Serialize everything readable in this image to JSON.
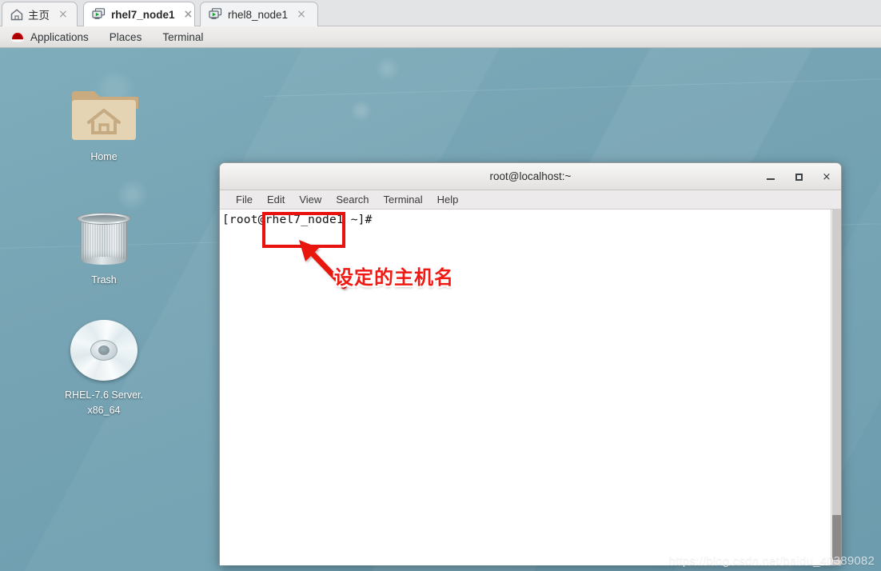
{
  "vmware_tabs": {
    "tabs": [
      {
        "label": "主页",
        "icon": "home-icon",
        "close": "×",
        "active": false
      },
      {
        "label": "rhel7_node1",
        "icon": "vm-icon",
        "close": "×",
        "active": true
      },
      {
        "label": "rhel8_node1",
        "icon": "vm-icon",
        "close": "×",
        "active": false
      }
    ]
  },
  "gnome_panel": {
    "logo": "redhat-logo-icon",
    "items": [
      {
        "label": "Applications"
      },
      {
        "label": "Places"
      },
      {
        "label": "Terminal"
      }
    ]
  },
  "desktop": {
    "background_color": "#74a3b3",
    "icons": [
      {
        "name": "home-folder",
        "label": "Home",
        "icon": "folder-home-icon"
      },
      {
        "name": "trash",
        "label": "Trash",
        "icon": "trash-bin-icon"
      },
      {
        "name": "cd-drive",
        "label_line1": "RHEL-7.6 Server.",
        "label_line2": "x86_64",
        "icon": "cd-disc-icon"
      }
    ]
  },
  "terminal": {
    "title": "root@localhost:~",
    "window_buttons": {
      "minimize": "minimize-icon",
      "maximize": "maximize-icon",
      "close": "×"
    },
    "menu": [
      {
        "label": "File"
      },
      {
        "label": "Edit"
      },
      {
        "label": "View"
      },
      {
        "label": "Search"
      },
      {
        "label": "Terminal"
      },
      {
        "label": "Help"
      }
    ],
    "prompt": "[root@rhel7_node1 ~]#",
    "prompt_user": "root",
    "prompt_host": "rhel7_node1",
    "prompt_cwd": "~"
  },
  "annotation": {
    "highlight_target": "rhel7_node1",
    "text": "设定的主机名",
    "color": "#e8120e"
  },
  "watermark": {
    "text": "https://blog.csdn.net/baidu_40389082"
  }
}
